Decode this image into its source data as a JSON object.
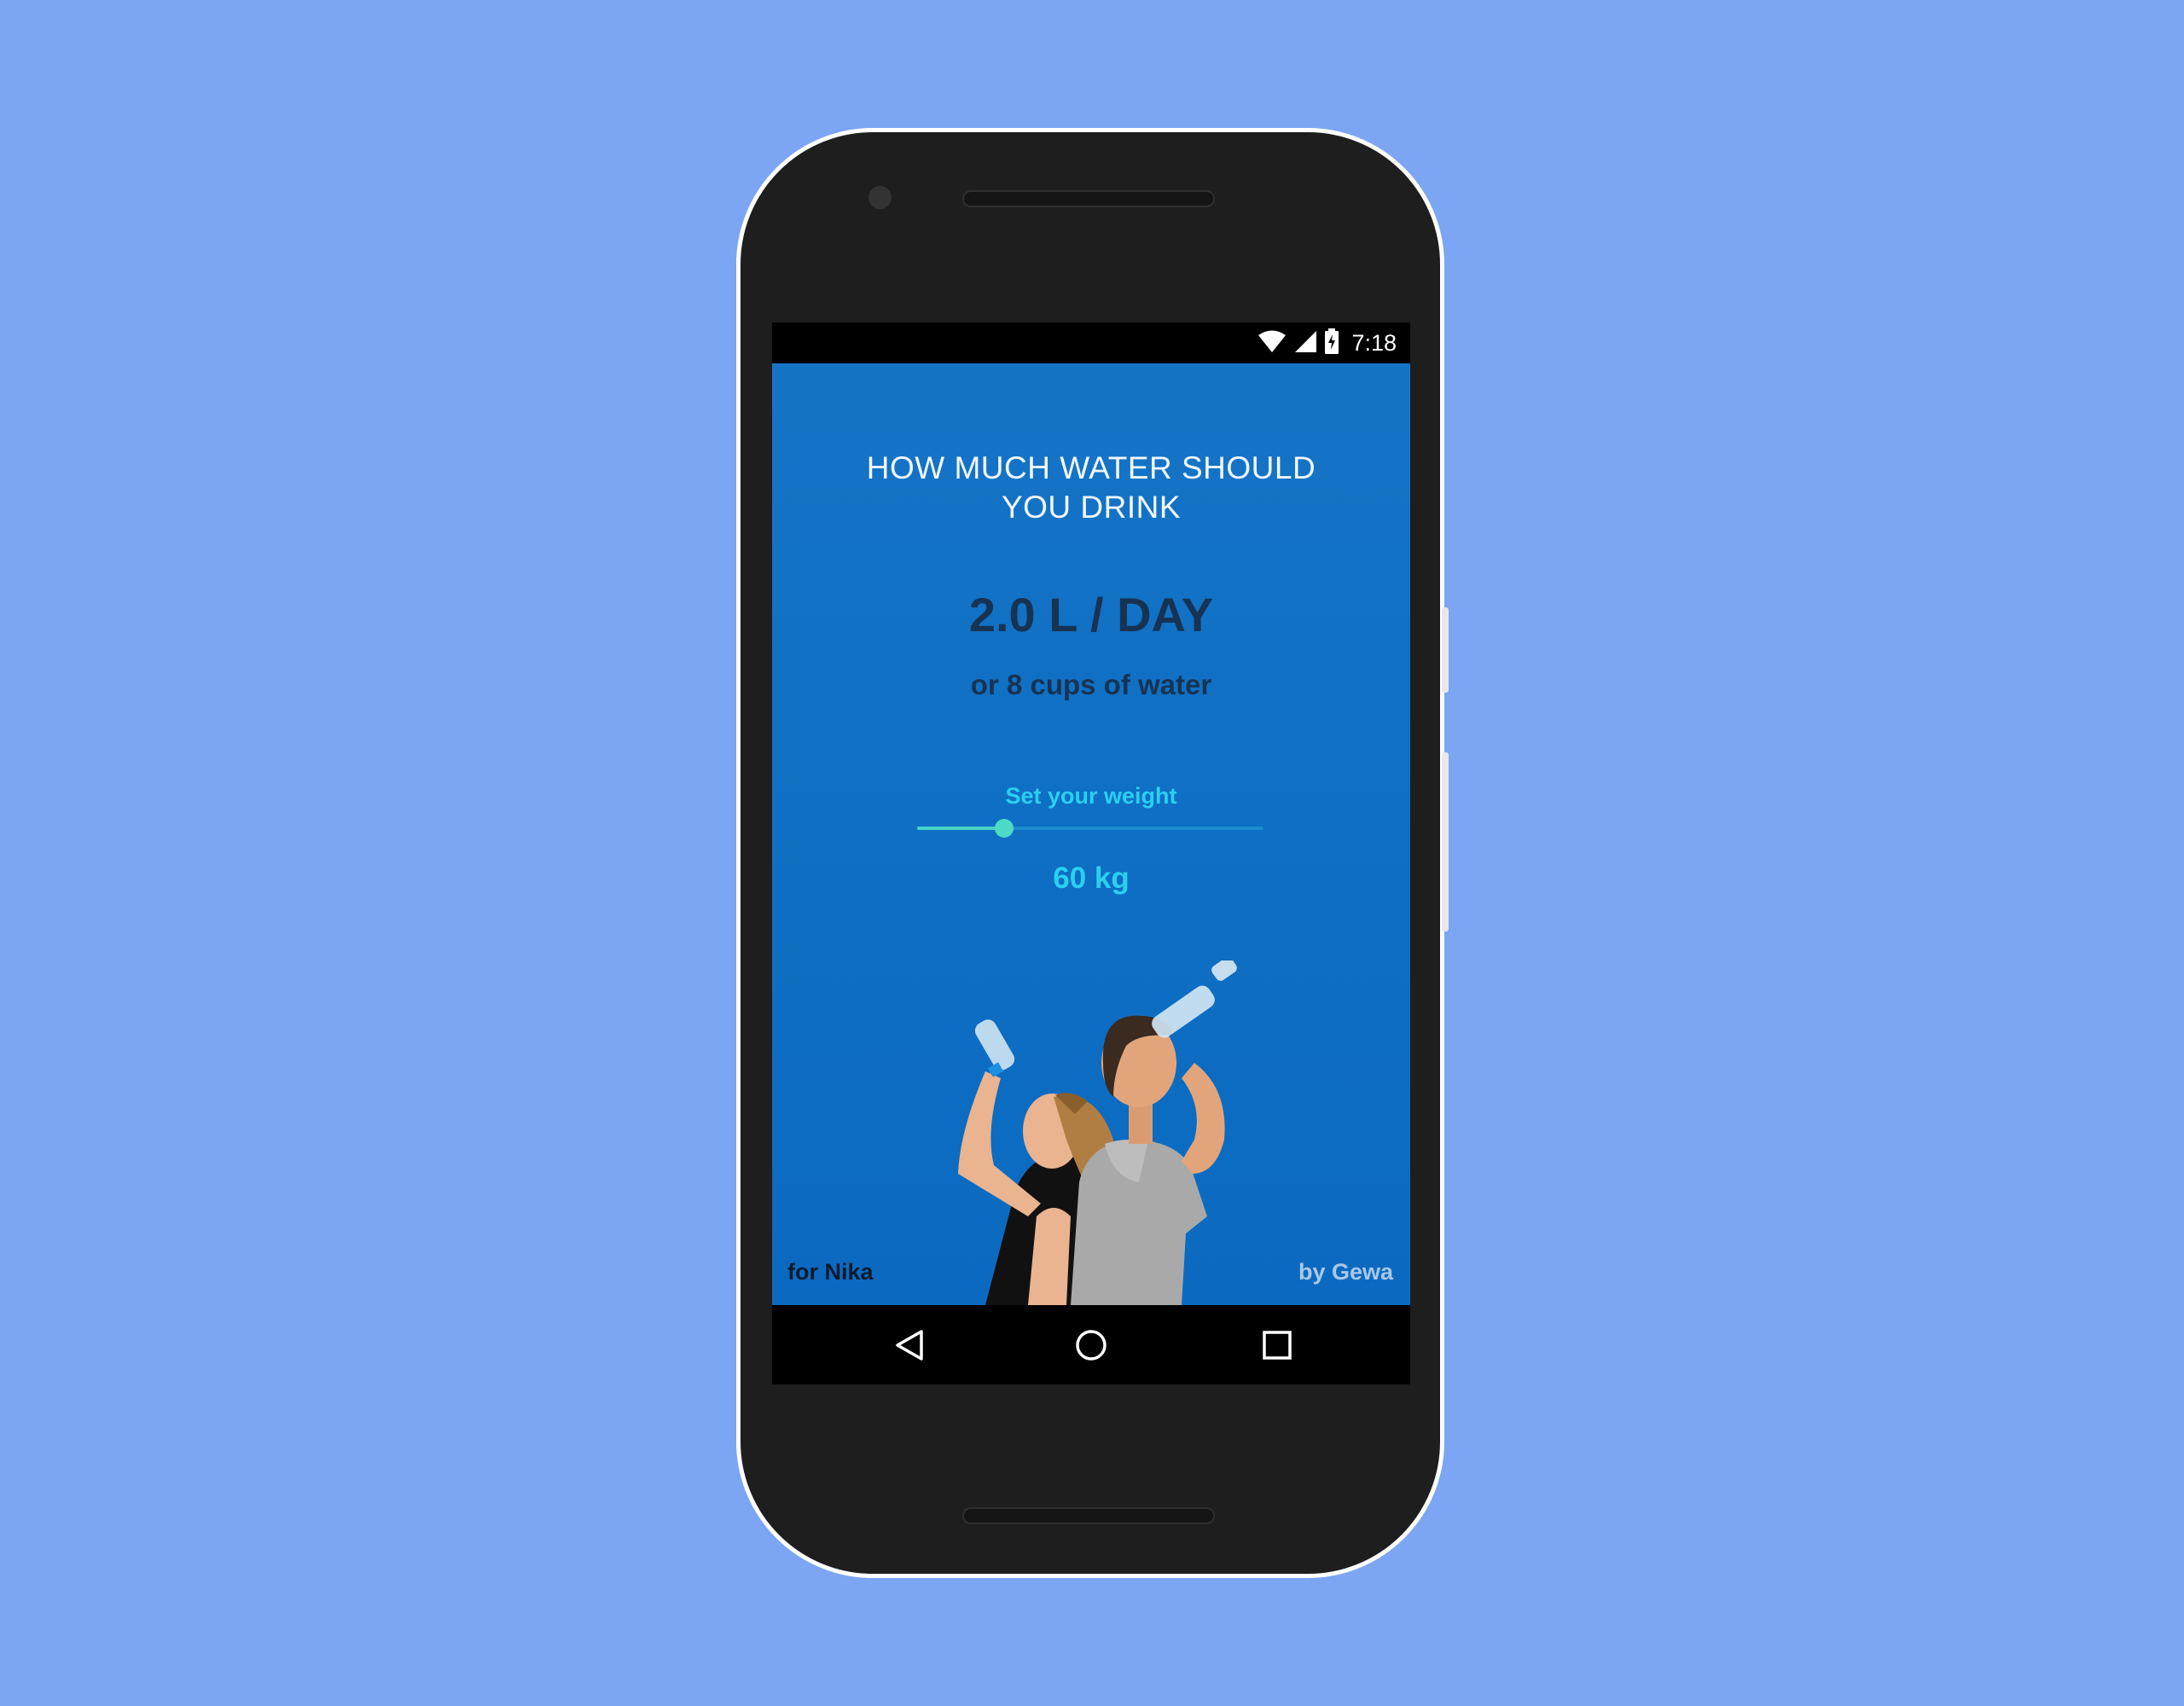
{
  "status_bar": {
    "time": "7:18",
    "icons": [
      "wifi-icon",
      "cellular-signal-icon",
      "battery-charging-icon"
    ]
  },
  "app": {
    "title_line1": "HOW MUCH WATER SHOULD",
    "title_line2": "YOU DRINK",
    "amount": "2.0 L / DAY",
    "cups": "or 8 cups of water",
    "weight_label": "Set your weight",
    "weight_value": "60 kg",
    "slider_level": 0.25,
    "footer_left": "for Nika",
    "footer_right": "by Gewa"
  },
  "nav_bar": {
    "buttons": [
      "back-icon",
      "home-icon",
      "recents-icon"
    ]
  },
  "colors": {
    "page_background": "#7ca5f3",
    "app_background": "#1170c4",
    "accent": "#2ad0f0",
    "slider_thumb": "#4fd9c9",
    "dark_text": "#173353"
  }
}
